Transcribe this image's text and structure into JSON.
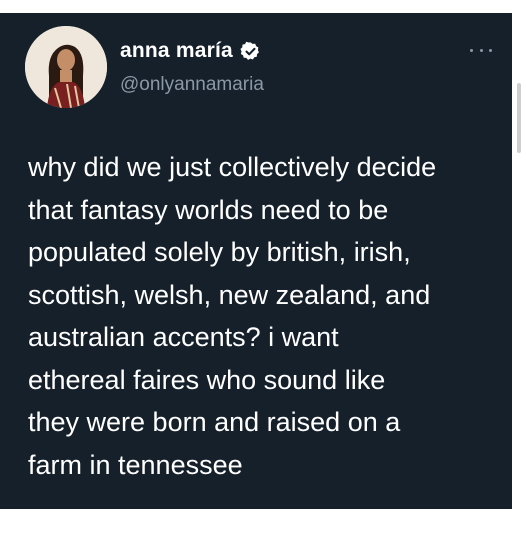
{
  "author": {
    "display_name": "anna maría",
    "handle": "@onlyannamaria",
    "verified": true,
    "avatar_icon": "profile-photo",
    "verified_icon": "verified-badge-icon"
  },
  "menu": {
    "icon": "more-options-icon"
  },
  "tweet": {
    "lines": [
      "why did we just collectively decide",
      "that fantasy worlds need to be",
      "populated solely by british, irish,",
      "scottish, welsh, new zealand, and",
      "australian accents? i want",
      "ethereal faires who sound like",
      "they were born and raised on a",
      "farm in tennessee"
    ]
  },
  "colors": {
    "background": "#15202b",
    "text": "#ffffff",
    "secondary_text": "#8b98a5",
    "verified_badge": "#ffffff"
  }
}
